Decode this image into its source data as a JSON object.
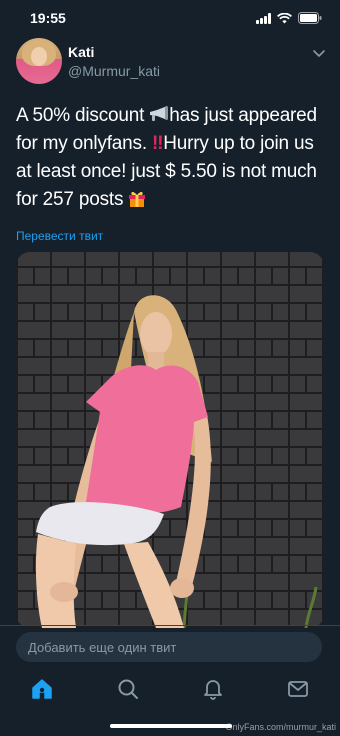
{
  "status_bar": {
    "time": "19:55",
    "icons": [
      "signal-icon",
      "wifi-icon",
      "battery-icon"
    ]
  },
  "tweet": {
    "author_name": "Kati",
    "author_handle": "@Murmur_kati",
    "text_parts": {
      "p1": "A 50% discount ",
      "p2": "has just appeared for my onlyfans. ",
      "bang": "‼",
      "p3": "Hurry up to join us at least once!  just $ 5.50 is not much for 257 posts "
    },
    "translate_label": "Перевести твит"
  },
  "composer": {
    "placeholder": "Добавить еще один твит"
  },
  "tabs": [
    {
      "name": "home-icon",
      "active": true
    },
    {
      "name": "search-icon",
      "active": false
    },
    {
      "name": "notifications-icon",
      "active": false
    },
    {
      "name": "messages-icon",
      "active": false
    }
  ],
  "watermark": "OnlyFans.com/murmur_kati",
  "colors": {
    "background": "#15202b",
    "accent": "#1da1f2",
    "secondary_text": "#8899a6",
    "composer_bg": "#253341"
  }
}
